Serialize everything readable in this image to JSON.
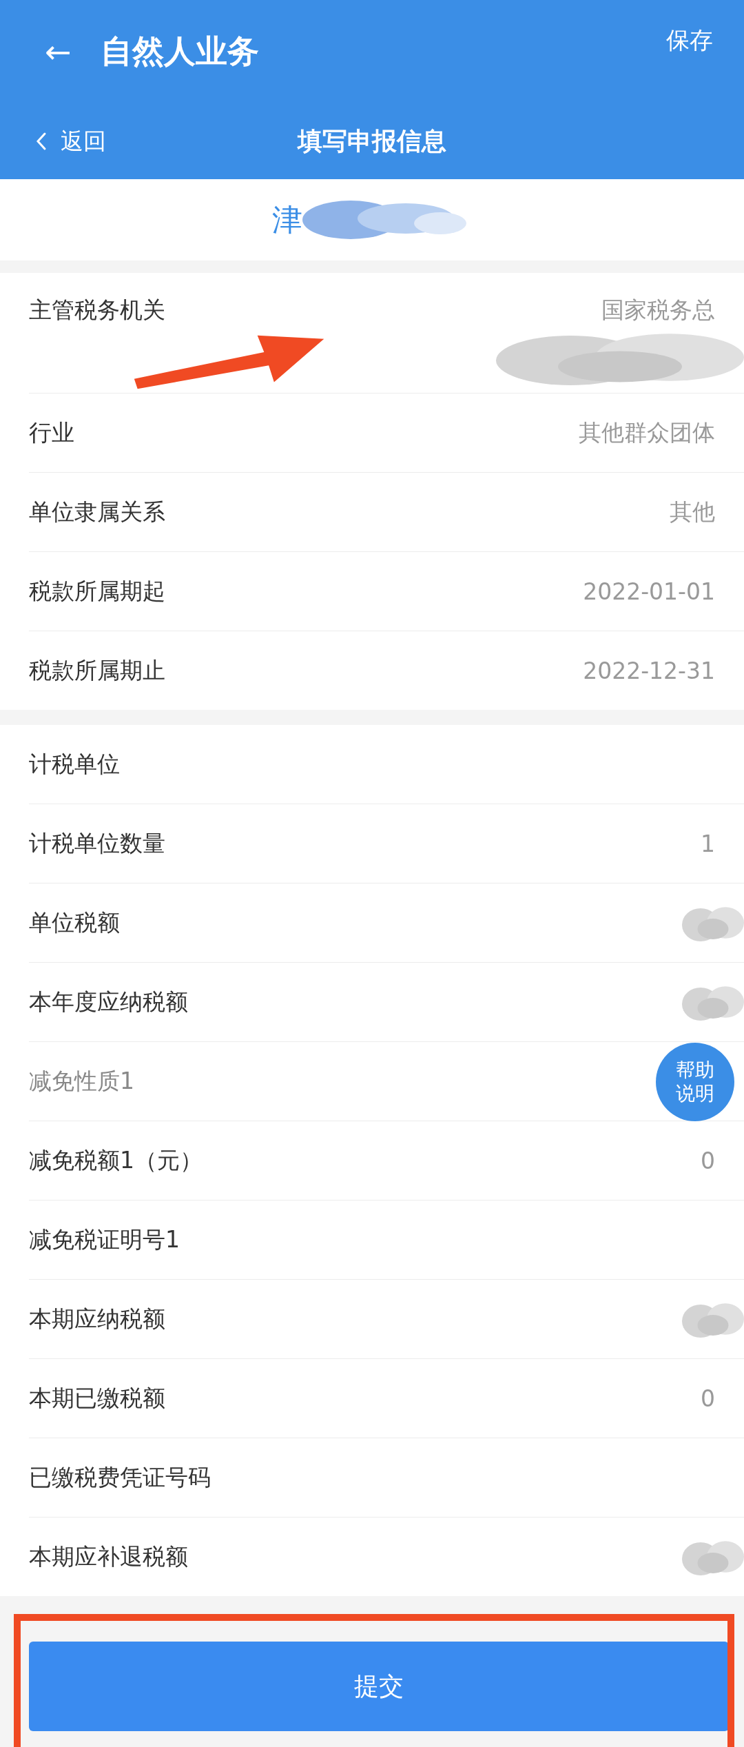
{
  "app_bar": {
    "back_icon": "←",
    "title": "自然人业务",
    "action": "保存"
  },
  "sub_bar": {
    "back": "返回",
    "title": "填写申报信息"
  },
  "taxpayer": {
    "name": "津",
    "redacted": true
  },
  "sections": [
    {
      "rows": [
        {
          "label": "主管税务机关",
          "value": "国家税务总",
          "redacted": true,
          "disabled": false
        },
        {
          "label": "行业",
          "value": "其他群众团体",
          "disabled": false
        },
        {
          "label": "单位隶属关系",
          "value": "其他",
          "disabled": false
        },
        {
          "label": "税款所属期起",
          "value": "2022-01-01",
          "disabled": false
        },
        {
          "label": "税款所属期止",
          "value": "2022-12-31",
          "disabled": false
        }
      ]
    },
    {
      "rows": [
        {
          "label": "计税单位",
          "disabled": false
        },
        {
          "label": "计税单位数量",
          "value": "1",
          "disabled": false
        },
        {
          "label": "单位税额",
          "redacted": true,
          "disabled": false
        },
        {
          "label": "本年度应纳税额",
          "redacted": true,
          "disabled": false
        },
        {
          "label": "减免性质1",
          "disabled": true
        },
        {
          "label": "减免税额1（元）",
          "value": "0",
          "disabled": false
        },
        {
          "label": "减免税证明号1",
          "disabled": false
        },
        {
          "label": "本期应纳税额",
          "redacted": true,
          "disabled": false
        },
        {
          "label": "本期已缴税额",
          "value": "0",
          "disabled": false
        },
        {
          "label": "已缴税费凭证号码",
          "disabled": false
        },
        {
          "label": "本期应补退税额",
          "redacted": true,
          "disabled": false
        }
      ]
    }
  ],
  "help_bubble": {
    "line1": "帮助",
    "line2": "说明"
  },
  "submit": "提交"
}
